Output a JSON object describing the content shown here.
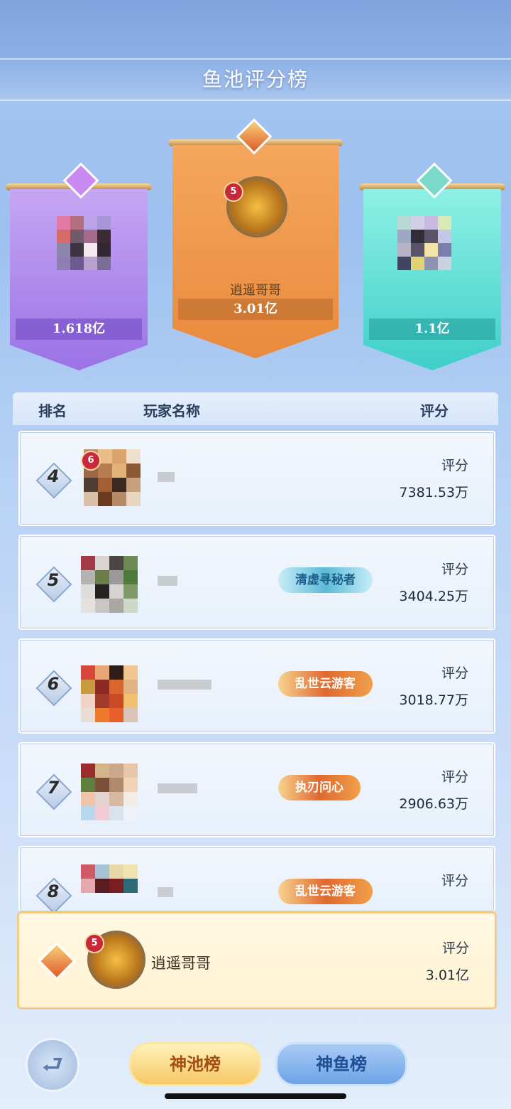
{
  "header": {
    "title": "鱼池评分榜"
  },
  "podium": {
    "first": {
      "name": "逍遥哥哥",
      "score": "3.01亿",
      "level": "5"
    },
    "second": {
      "name": "",
      "score": "1.618亿"
    },
    "third": {
      "name": "",
      "score": "1.1亿"
    }
  },
  "table": {
    "headers": {
      "rank": "排名",
      "player": "玩家名称",
      "score": "评分"
    },
    "rows": [
      {
        "rank": "4",
        "level": "6",
        "title": "",
        "score_label": "评分",
        "score": "7381.53万"
      },
      {
        "rank": "5",
        "title": "清虚寻秘者",
        "score_label": "评分",
        "score": "3404.25万"
      },
      {
        "rank": "6",
        "title": "乱世云游客",
        "score_label": "评分",
        "score": "3018.77万"
      },
      {
        "rank": "7",
        "title": "执刃问心",
        "score_label": "评分",
        "score": "2906.63万"
      },
      {
        "rank": "8",
        "title": "乱世云游客",
        "score_label": "评分",
        "score": ""
      }
    ]
  },
  "self": {
    "name": "逍遥哥哥",
    "level": "5",
    "score_label": "评分",
    "score": "3.01亿"
  },
  "tabs": {
    "active": "神池榜",
    "inactive": "神鱼榜"
  },
  "icons": {
    "back": "back-arrow-icon",
    "crown": "crown-icon"
  },
  "colors": {
    "first": "#e98a3c",
    "second": "#9a72e6",
    "third": "#3ecfc8"
  }
}
